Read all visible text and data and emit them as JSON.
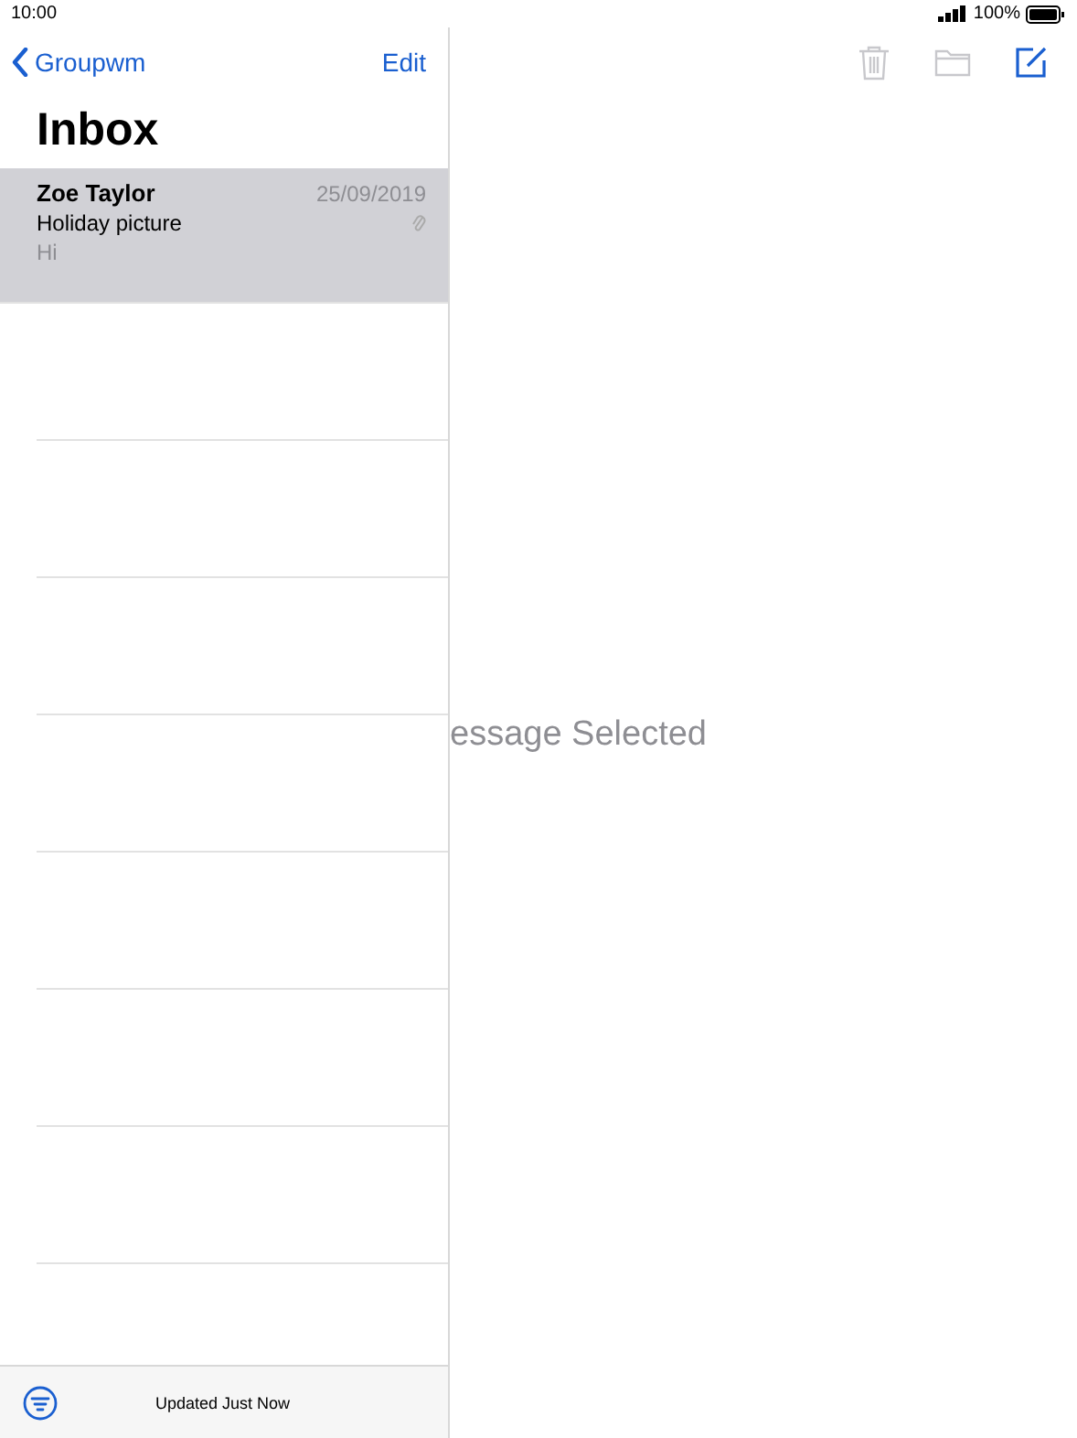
{
  "status_bar": {
    "time": "10:00",
    "battery": "100%"
  },
  "sidebar": {
    "back": "Groupwm",
    "edit": "Edit",
    "title": "Inbox",
    "messages": [
      {
        "sender": "Zoe Taylor",
        "date": "25/09/2019",
        "subject": "Holiday picture",
        "preview": "Hi",
        "attachment": true,
        "selected": true
      }
    ],
    "footer": "Updated Just Now"
  },
  "toolbar": [
    {
      "kind": "trash",
      "disabled": true
    },
    {
      "kind": "folder",
      "disabled": true
    },
    {
      "kind": "compose",
      "disabled": false
    }
  ],
  "detail": {
    "empty_text": "essage Selected"
  }
}
